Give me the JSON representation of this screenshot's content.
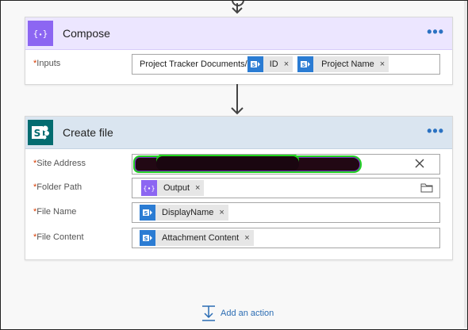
{
  "compose": {
    "title": "Compose",
    "icon": "braces-icon",
    "more": "•••",
    "inputs": {
      "required_mark": "*",
      "label": "Inputs",
      "prefix_text": "Project Tracker Documents/",
      "tokens": [
        {
          "label": "ID",
          "source": "sharepoint-icon"
        },
        {
          "label": "Project Name",
          "source": "sharepoint-icon"
        }
      ]
    }
  },
  "create_file": {
    "title": "Create file",
    "icon": "sharepoint-icon",
    "more": "•••",
    "fields": [
      {
        "required_mark": "*",
        "label": "Site Address"
      },
      {
        "required_mark": "*",
        "label": "Folder Path",
        "token": {
          "label": "Output",
          "source": "braces-icon"
        }
      },
      {
        "required_mark": "*",
        "label": "File Name",
        "token": {
          "label": "DisplayName",
          "source": "sharepoint-icon"
        }
      },
      {
        "required_mark": "*",
        "label": "File Content",
        "token": {
          "label": "Attachment Content",
          "source": "sharepoint-icon"
        }
      }
    ]
  },
  "token_remove_glyph": "×",
  "add_action": {
    "label": "Add an action"
  },
  "colors": {
    "compose_accent": "#8c66f2",
    "compose_header": "#ece6ff",
    "sharepoint_teal": "#036c70",
    "sharepoint_blue": "#2b7cd3",
    "createfile_header": "#dae5f0",
    "required": "#d83b01",
    "link": "#2b6cb3"
  }
}
